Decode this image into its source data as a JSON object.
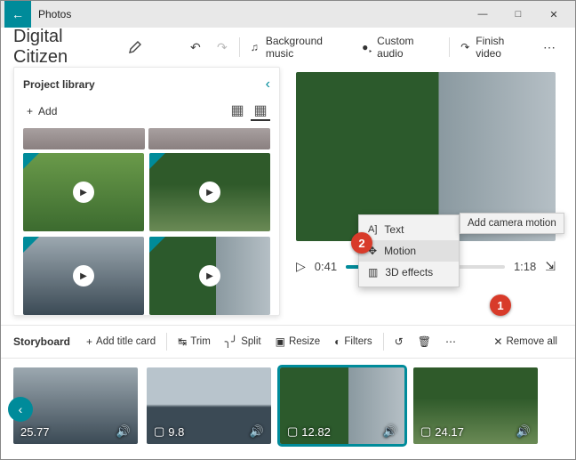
{
  "titlebar": {
    "app_name": "Photos"
  },
  "header": {
    "project_title": "Digital Citizen",
    "bg_music": "Background music",
    "custom_audio": "Custom audio",
    "finish": "Finish video"
  },
  "library": {
    "title": "Project library",
    "add_label": "Add"
  },
  "preview": {
    "current_time": "0:41",
    "total_time": "1:18"
  },
  "context_menu": {
    "text": "Text",
    "motion": "Motion",
    "effects": "3D effects",
    "tooltip": "Add camera motion"
  },
  "storyboard": {
    "label": "Storyboard",
    "add_title_card": "Add title card",
    "trim": "Trim",
    "split": "Split",
    "resize": "Resize",
    "filters": "Filters",
    "remove_all": "Remove all",
    "clips": [
      {
        "duration": "25.77",
        "has_box": false
      },
      {
        "duration": "9.8",
        "has_box": true
      },
      {
        "duration": "12.82",
        "has_box": true
      },
      {
        "duration": "24.17",
        "has_box": true
      }
    ]
  },
  "badges": {
    "one": "1",
    "two": "2"
  }
}
